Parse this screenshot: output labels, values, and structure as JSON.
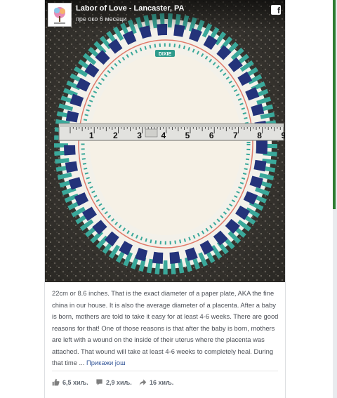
{
  "post": {
    "page_name": "Labor of Love - Lancaster, PA",
    "time": "пре око 6 месеци",
    "caption": "22cm or 8.6 inches. That is the exact diameter of a paper plate, AKA the fine china in our house. It is also the average diameter of a placenta. After a baby is born, mothers are told to take it easy for at least 4-6 weeks. There are good reasons for that! One of those reasons is that after the baby is born, mothers are left with a wound on the inside of their uterus where the placenta was attached. That wound will take at least 4-6 weeks to completely heal. During that time ...",
    "see_more": "Прикажи још"
  },
  "photo": {
    "ruler_numbers": [
      "1",
      "2",
      "3",
      "4",
      "5",
      "6",
      "7",
      "8",
      "9"
    ],
    "plate_brand": "DIXIE"
  },
  "stats": {
    "likes": "6,5 хиљ.",
    "comments": "2,9 хиљ.",
    "shares": "16 хиљ."
  },
  "icons": {
    "facebook": "facebook-icon",
    "like": "like-icon",
    "comment": "comment-icon",
    "share": "share-icon"
  },
  "colors": {
    "link": "#365899",
    "plate_teal": "#3aa89a",
    "plate_navy": "#24337a",
    "counter_dark": "#3a3733"
  }
}
